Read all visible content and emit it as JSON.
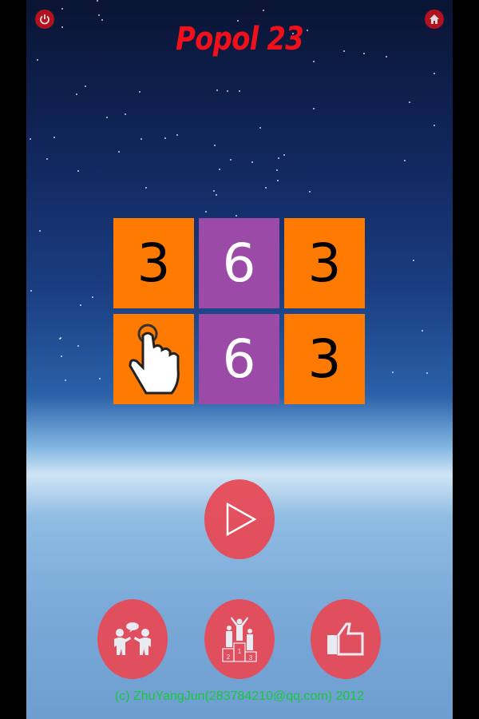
{
  "title": "Popol 23",
  "grid": {
    "tiles": [
      {
        "value": "3",
        "color": "#ff7a00",
        "text_color": "#000000"
      },
      {
        "value": "6",
        "color": "#9b4aa8",
        "text_color": "#ffffff"
      },
      {
        "value": "3",
        "color": "#ff7a00",
        "text_color": "#000000"
      },
      {
        "value": "",
        "color": "#ff7a00",
        "text_color": "#000000",
        "icon": "hand-pointer-icon"
      },
      {
        "value": "6",
        "color": "#9b4aa8",
        "text_color": "#ffffff"
      },
      {
        "value": "3",
        "color": "#ff7a00",
        "text_color": "#000000"
      }
    ]
  },
  "buttons": {
    "power": "power-icon",
    "home": "home-icon",
    "play": "play-icon",
    "social": "people-chat-icon",
    "leaderboard": "podium-icon",
    "like": "thumbs-up-icon"
  },
  "podium_labels": [
    "2",
    "1",
    "3"
  ],
  "footer": "(c) ZhuYangJun(283784210@qq.com) 2012",
  "colors": {
    "title": "#f0101a",
    "button": "#e84854",
    "footer": "#19c83a"
  }
}
